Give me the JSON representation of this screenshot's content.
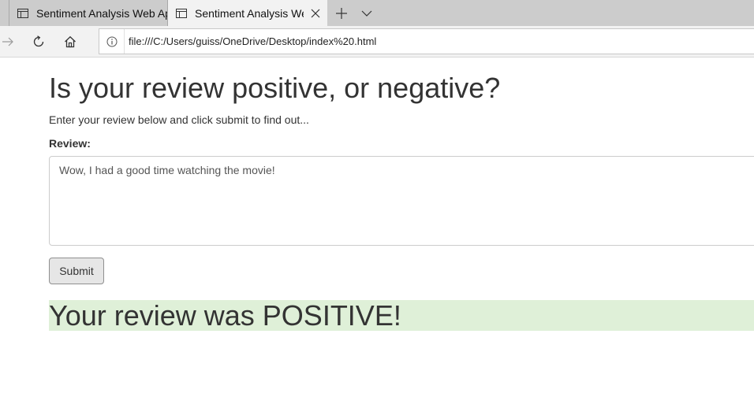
{
  "browser": {
    "tabs": [
      {
        "title": "Sentiment Analysis Web Ap",
        "active": false
      },
      {
        "title": "Sentiment Analysis Web",
        "active": true
      }
    ],
    "address": "file:///C:/Users/guiss/OneDrive/Desktop/index%20.html"
  },
  "page": {
    "title": "Is your review positive, or negative?",
    "subtitle": "Enter your review below and click submit to find out...",
    "review_label": "Review:",
    "review_value": "Wow, I had a good time watching the movie!",
    "submit_label": "Submit",
    "result_text": "Your review was POSITIVE!"
  },
  "colors": {
    "result_background": "#dff0d8",
    "tabbar_background": "#cccccc"
  },
  "icons": [
    "tab-page-icon",
    "close-icon",
    "plus-icon",
    "chevron-down-icon",
    "forward-arrow-icon",
    "refresh-icon",
    "home-icon",
    "info-icon"
  ]
}
